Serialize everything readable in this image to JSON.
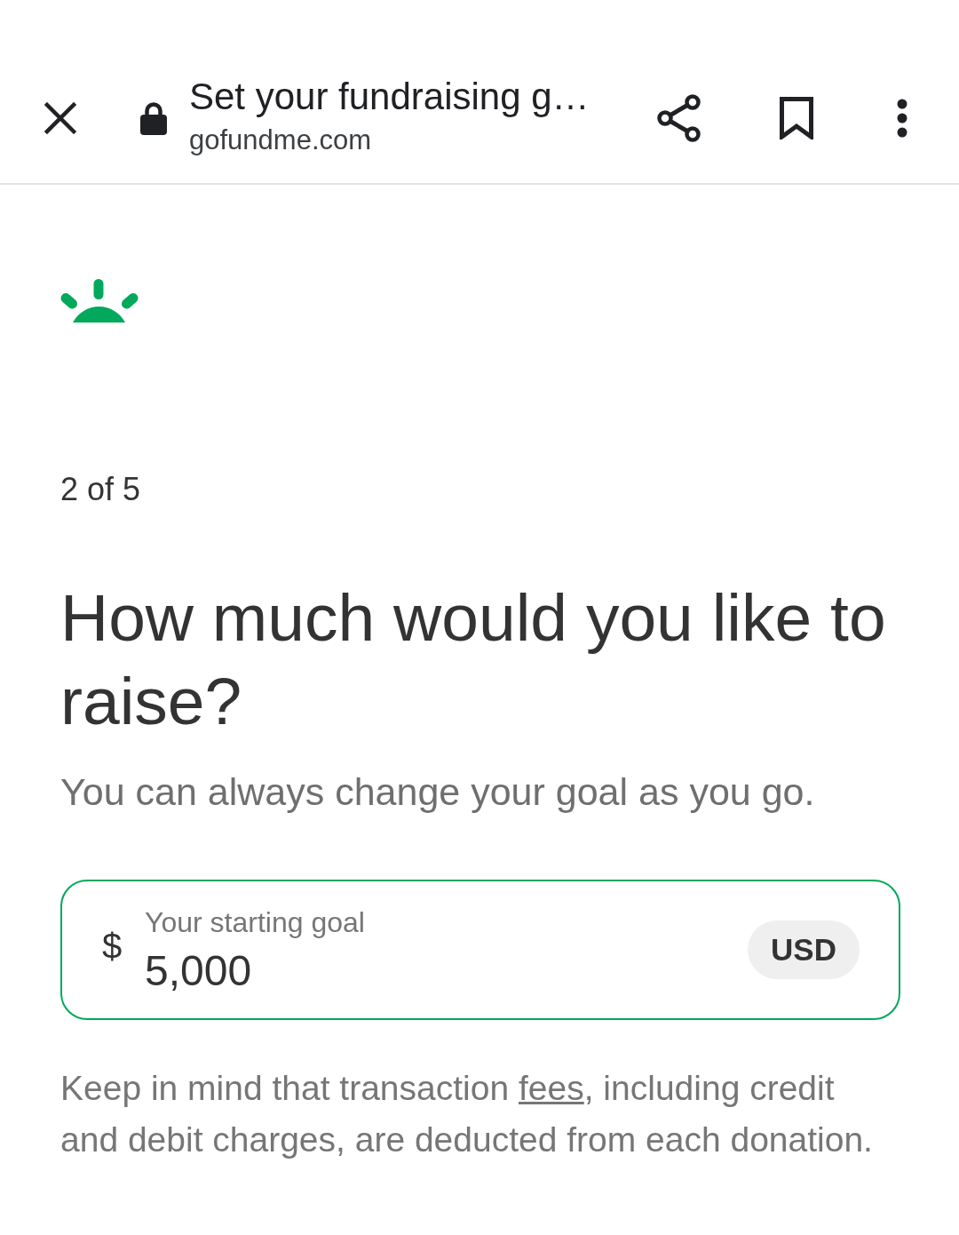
{
  "browser_bar": {
    "title": "Set your fundraising g…",
    "domain": "gofundme.com",
    "secure": true
  },
  "step": "2 of 5",
  "heading": "How much would you like to raise?",
  "subtitle": "You can always change your goal as you go.",
  "goal_field": {
    "label": "Your starting goal",
    "currency_symbol": "$",
    "value": "5,000",
    "currency": "USD",
    "focused": true
  },
  "note": {
    "text_before": "Keep in mind that transaction ",
    "link": "fees",
    "text_after": ", including credit and debit charges, are deducted from each donation."
  }
}
